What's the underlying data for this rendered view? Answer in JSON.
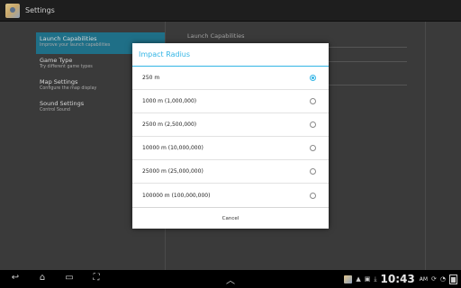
{
  "app": {
    "title": "Settings"
  },
  "headers": [
    {
      "title": "Launch Capabilities",
      "subtitle": "Improve your launch capabilities",
      "selected": true
    },
    {
      "title": "Game Type",
      "subtitle": "Try different game types"
    },
    {
      "title": "Map Settings",
      "subtitle": "Configure the map display"
    },
    {
      "title": "Sound Settings",
      "subtitle": "Control Sound"
    }
  ],
  "detail": {
    "first_pref": "Launch Capabilities"
  },
  "dialog": {
    "title": "Impact Radius",
    "options": [
      {
        "label": "250 m",
        "checked": true
      },
      {
        "label": "1000 m (1,000,000)",
        "checked": false
      },
      {
        "label": "2500 m (2,500,000)",
        "checked": false
      },
      {
        "label": "10000 m (10,000,000)",
        "checked": false
      },
      {
        "label": "25000 m (25,000,000)",
        "checked": false
      },
      {
        "label": "100000 m (100,000,000)",
        "checked": false
      }
    ],
    "cancel_label": "Cancel"
  },
  "status": {
    "time": "10:43",
    "ampm": "AM"
  },
  "colors": {
    "accent": "#33b5e5",
    "selected_header": "#1f6f87"
  }
}
